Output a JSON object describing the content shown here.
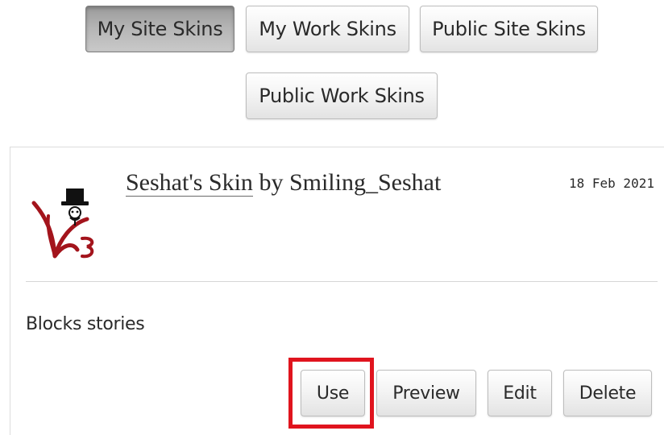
{
  "tabs": [
    {
      "label": "My Site Skins",
      "active": true
    },
    {
      "label": "My Work Skins",
      "active": false
    },
    {
      "label": "Public Site Skins",
      "active": false
    },
    {
      "label": "Public Work Skins",
      "active": false
    }
  ],
  "skin": {
    "title": "Seshat's Skin",
    "by": "by",
    "author": "Smiling_Seshat",
    "date": "18 Feb 2021",
    "description": "Blocks stories",
    "icon": "top-hat-mascot-icon"
  },
  "actions": {
    "use": "Use",
    "preview": "Preview",
    "edit": "Edit",
    "delete": "Delete"
  },
  "colors": {
    "highlight": "#e0141e",
    "active_tab": "#b6b6b6",
    "icon_red": "#a3141c"
  }
}
